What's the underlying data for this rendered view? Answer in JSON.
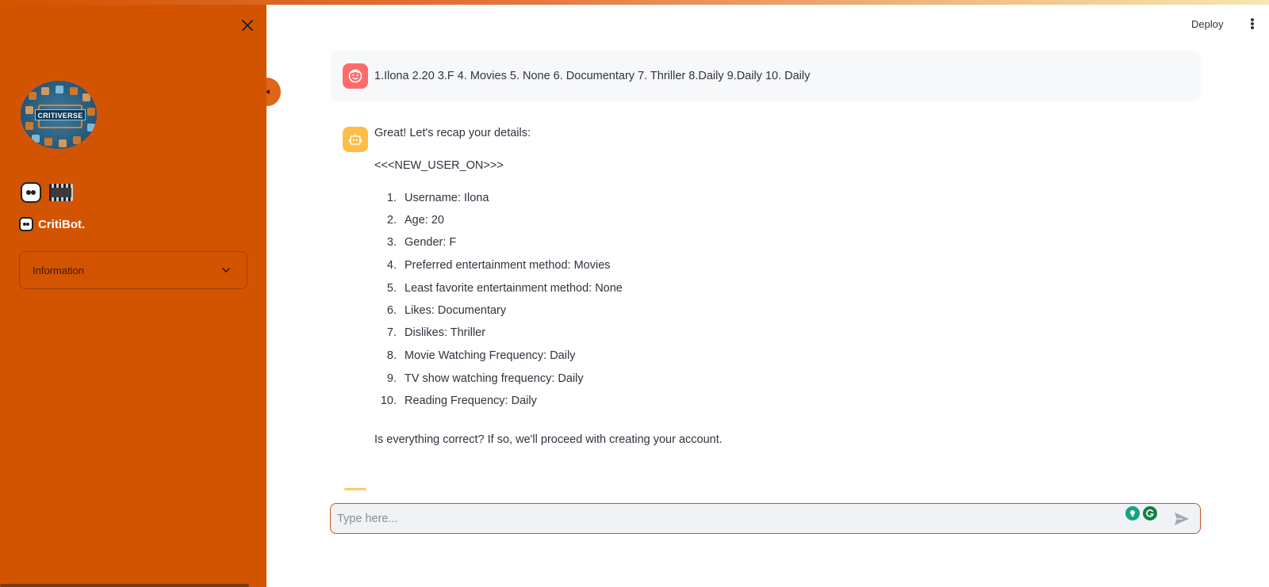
{
  "sidebar": {
    "logo_text": "CRITIVERSE",
    "emojis": [
      "robot-icon",
      "film-frames-icon"
    ],
    "bot_title": "CritiBot.",
    "expander_label": "Information",
    "background": "#d35400"
  },
  "header": {
    "deploy_label": "Deploy"
  },
  "chat": {
    "user_message": "1.Ilona 2.20 3.F 4. Movies 5. None 6. Documentary 7. Thriller 8.Daily 9.Daily 10. Daily",
    "assistant": {
      "intro": "Great! Let's recap your details:",
      "tag": "<<<NEW_USER_ON>>>",
      "items": [
        {
          "num": "1.",
          "text": "Username: Ilona"
        },
        {
          "num": "2.",
          "text": "Age: 20"
        },
        {
          "num": "3.",
          "text": "Gender: F"
        },
        {
          "num": "4.",
          "text": "Preferred entertainment method: Movies"
        },
        {
          "num": "5.",
          "text": "Least favorite entertainment method: None"
        },
        {
          "num": "6.",
          "text": "Likes: Documentary"
        },
        {
          "num": "7.",
          "text": "Dislikes: Thriller"
        },
        {
          "num": "8.",
          "text": "Movie Watching Frequency: Daily"
        },
        {
          "num": "9.",
          "text": "TV show watching frequency: Daily"
        },
        {
          "num": "10.",
          "text": "Reading Frequency: Daily"
        }
      ],
      "closing": "Is everything correct? If so, we'll proceed with creating your account."
    }
  },
  "input": {
    "placeholder": "Type here...",
    "value": ""
  },
  "colors": {
    "accent": "#d35400",
    "user_avatar": "#ff6b6b",
    "bot_avatar": "#ffbd45"
  }
}
